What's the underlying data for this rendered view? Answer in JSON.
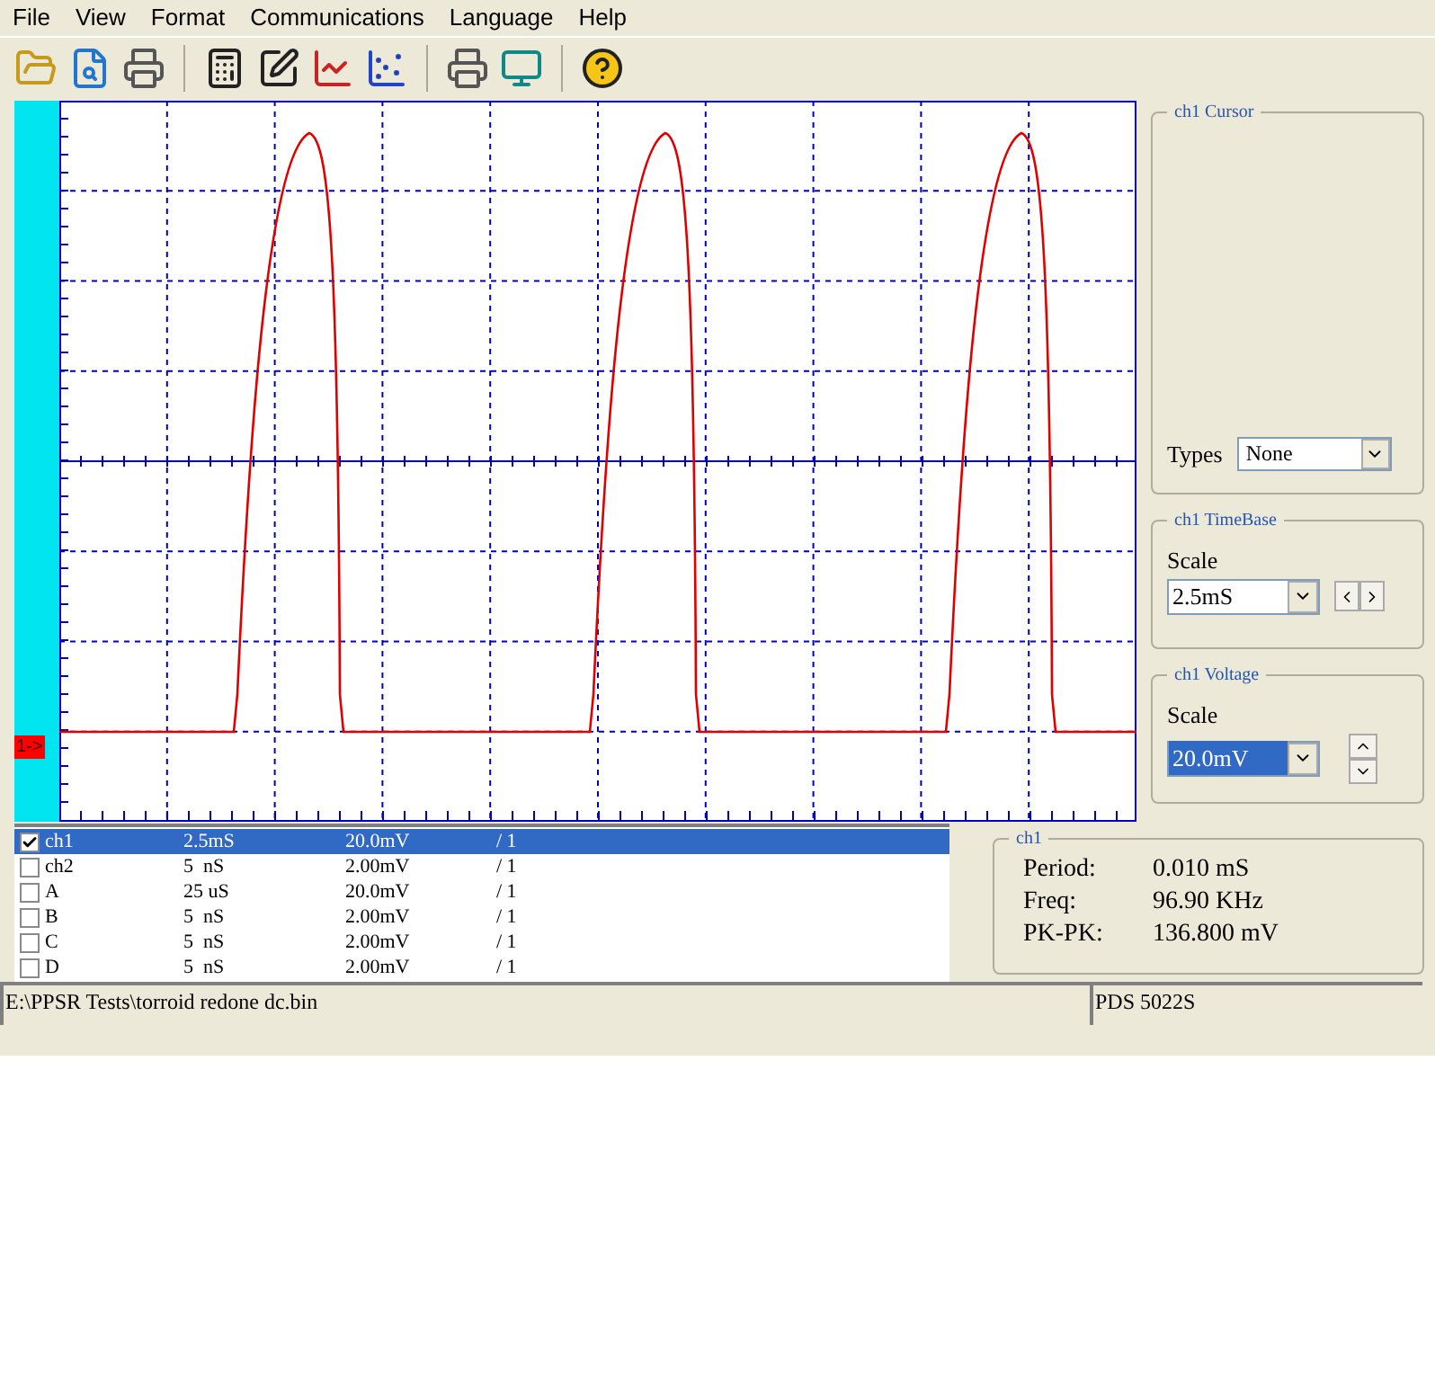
{
  "menu": [
    "File",
    "View",
    "Format",
    "Communications",
    "Language",
    "Help"
  ],
  "scope": {
    "marker": "1->"
  },
  "channels": [
    {
      "checked": true,
      "selected": true,
      "name": "ch1",
      "time": "2.5mS",
      "volts": "20.0mV",
      "ratio": "/ 1"
    },
    {
      "checked": false,
      "selected": false,
      "name": "ch2",
      "time": "5  nS",
      "volts": "2.00mV",
      "ratio": "/ 1"
    },
    {
      "checked": false,
      "selected": false,
      "name": "A",
      "time": "25 uS",
      "volts": "20.0mV",
      "ratio": "/ 1"
    },
    {
      "checked": false,
      "selected": false,
      "name": "B",
      "time": "5  nS",
      "volts": "2.00mV",
      "ratio": "/ 1"
    },
    {
      "checked": false,
      "selected": false,
      "name": "C",
      "time": "5  nS",
      "volts": "2.00mV",
      "ratio": "/ 1"
    },
    {
      "checked": false,
      "selected": false,
      "name": "D",
      "time": "5  nS",
      "volts": "2.00mV",
      "ratio": "/ 1"
    }
  ],
  "cursor": {
    "title": "ch1 Cursor",
    "types_label": "Types",
    "types_value": "None"
  },
  "timebase": {
    "title": "ch1 TimeBase",
    "scale_label": "Scale",
    "scale_value": "2.5mS"
  },
  "voltage": {
    "title": "ch1 Voltage",
    "scale_label": "Scale",
    "scale_value": "20.0mV"
  },
  "measurements": {
    "title": "ch1",
    "rows": [
      {
        "label": "Period:",
        "value": "0.010 mS"
      },
      {
        "label": "Freq:",
        "value": "96.90 KHz"
      },
      {
        "label": "PK-PK:",
        "value": "136.800 mV"
      }
    ]
  },
  "status_bar": {
    "file": "E:\\PPSR Tests\\torroid redone dc.bin",
    "device": "PDS 5022S"
  }
}
